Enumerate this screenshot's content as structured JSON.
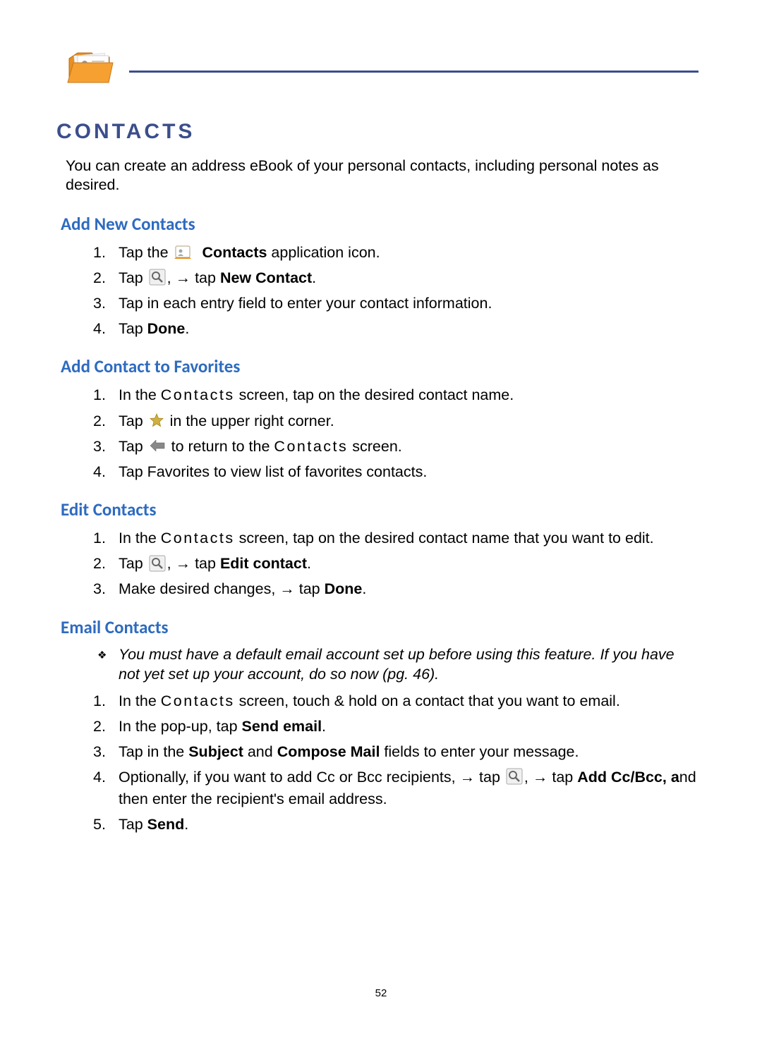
{
  "page_number": "52",
  "section_title": "CONTACTS",
  "intro": "You can create an address eBook of your personal contacts, including personal notes as desired.",
  "sub1": {
    "heading": "Add New Contacts"
  },
  "s1": {
    "step1a": "Tap the ",
    "step1b": "Contacts",
    "step1c": " application icon.",
    "step2a": "Tap ",
    "step2b": ", ",
    "step2c": " tap ",
    "step2d": "New Contact",
    "step2e": ".",
    "step3": "Tap in each entry field to enter your contact information.",
    "step4a": "Tap ",
    "step4b": "Done",
    "step4c": "."
  },
  "sub2": {
    "heading": "Add Contact to Favorites"
  },
  "s2": {
    "step1a": "In the ",
    "step1b": "Contacts",
    "step1c": " screen, tap on the desired contact name.",
    "step2a": "Tap ",
    "step2b": " in the upper right corner.",
    "step3a": "Tap ",
    "step3b": " to return to the ",
    "step3c": "Contacts",
    "step3d": " screen.",
    "step4": "Tap Favorites to view list of favorites contacts."
  },
  "sub3": {
    "heading": "Edit Contacts"
  },
  "s3": {
    "step1a": "In the ",
    "step1b": "Contacts",
    "step1c": " screen, tap on the desired contact name that you want to edit.",
    "step2a": "Tap ",
    "step2b": ", ",
    "step2c": " tap ",
    "step2d": "Edit contact",
    "step2e": ".",
    "step3a": "Make desired changes, ",
    "step3b": " tap ",
    "step3c": "Done",
    "step3d": "."
  },
  "sub4": {
    "heading": "Email Contacts"
  },
  "s4note": "You must have a default email account set up before using this feature. If you have not yet set up your account, do so now (pg. 46).",
  "s4": {
    "step1a": "In the ",
    "step1b": "Contacts",
    "step1c": " screen, touch & hold on a contact that you want to email.",
    "step2a": "In the pop-up, tap ",
    "step2b": "Send email",
    "step2c": ".",
    "step3a": "Tap in the ",
    "step3b": "Subject",
    "step3c": " and ",
    "step3d": "Compose Mail",
    "step3e": " fields to enter your message.",
    "step4a": "Optionally, if you want to add Cc or Bcc recipients, ",
    "step4b": " tap ",
    "step4c": ", ",
    "step4d": " tap ",
    "step4e": "Add Cc/Bcc, a",
    "step4f": "nd then enter the recipient's email address.",
    "step5a": "Tap ",
    "step5b": "Send",
    "step5c": "."
  },
  "arrow": "→"
}
